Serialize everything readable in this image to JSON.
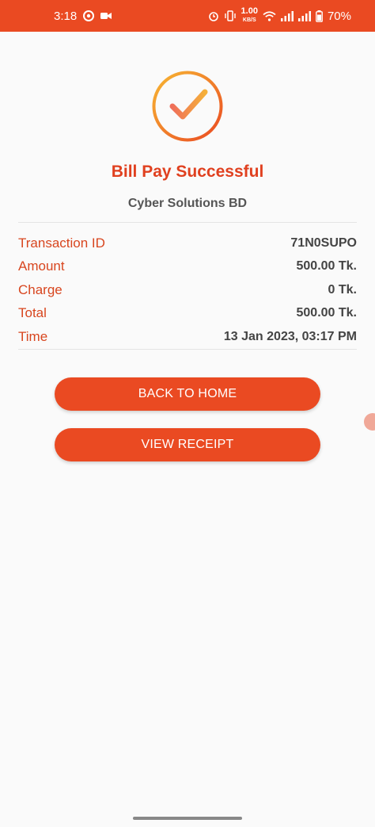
{
  "status_bar": {
    "time": "3:18",
    "net_speed_value": "1.00",
    "net_speed_unit": "KB/S",
    "battery": "70%",
    "icons": [
      "chrome-icon",
      "video-icon",
      "alarm-icon",
      "vibrate-icon",
      "wifi-icon",
      "signal-icon",
      "signal-icon",
      "battery-icon"
    ]
  },
  "result": {
    "icon": "check-circle-icon",
    "title": "Bill Pay Successful",
    "merchant": "Cyber Solutions BD"
  },
  "details": [
    {
      "label": "Transaction ID",
      "value": "71N0SUPO"
    },
    {
      "label": "Amount",
      "value": "500.00 Tk."
    },
    {
      "label": "Charge",
      "value": "0 Tk."
    },
    {
      "label": "Total",
      "value": "500.00 Tk."
    },
    {
      "label": "Time",
      "value": "13 Jan 2023, 03:17 PM"
    }
  ],
  "actions": {
    "back_home": "BACK TO HOME",
    "view_receipt": "VIEW RECEIPT"
  },
  "colors": {
    "accent": "#ea4a22",
    "title": "#e0401f",
    "label": "#d8461f",
    "gradient_start": "#f7b733",
    "gradient_end": "#ea4a22"
  }
}
